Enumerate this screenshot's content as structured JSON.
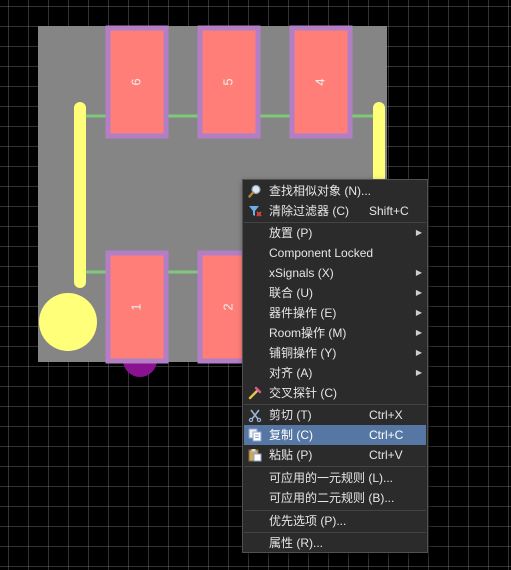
{
  "pcb": {
    "pads": [
      "6",
      "5",
      "4",
      "1",
      "2"
    ]
  },
  "context_menu": {
    "items": [
      {
        "icon": "magnifier-icon",
        "label": "查找相似对象 (N)...",
        "shortcut": "",
        "submenu": false
      },
      {
        "icon": "clear-filter-icon",
        "label": "清除过滤器 (C)",
        "shortcut": "Shift+C",
        "submenu": false
      },
      {
        "icon": "",
        "label": "放置 (P)",
        "shortcut": "",
        "submenu": true
      },
      {
        "icon": "",
        "label": "Component Locked",
        "shortcut": "",
        "submenu": false
      },
      {
        "icon": "",
        "label": "xSignals (X)",
        "shortcut": "",
        "submenu": true
      },
      {
        "icon": "",
        "label": "联合 (U)",
        "shortcut": "",
        "submenu": true
      },
      {
        "icon": "",
        "label": "器件操作 (E)",
        "shortcut": "",
        "submenu": true
      },
      {
        "icon": "",
        "label": "Room操作 (M)",
        "shortcut": "",
        "submenu": true
      },
      {
        "icon": "",
        "label": "铺铜操作 (Y)",
        "shortcut": "",
        "submenu": true
      },
      {
        "icon": "",
        "label": "对齐 (A)",
        "shortcut": "",
        "submenu": true
      },
      {
        "icon": "cross-probe-icon",
        "label": "交叉探针 (C)",
        "shortcut": "",
        "submenu": false
      },
      {
        "icon": "scissors-icon",
        "label": "剪切 (T)",
        "shortcut": "Ctrl+X",
        "submenu": false
      },
      {
        "icon": "copy-icon",
        "label": "复制 (C)",
        "shortcut": "Ctrl+C",
        "submenu": false,
        "highlighted": true
      },
      {
        "icon": "paste-icon",
        "label": "粘贴 (P)",
        "shortcut": "Ctrl+V",
        "submenu": false
      },
      {
        "icon": "",
        "label": "可应用的一元规则 (L)...",
        "shortcut": "",
        "submenu": false
      },
      {
        "icon": "",
        "label": "可应用的二元规则 (B)...",
        "shortcut": "",
        "submenu": false
      },
      {
        "icon": "",
        "label": "优先选项 (P)...",
        "shortcut": "",
        "submenu": false
      },
      {
        "icon": "",
        "label": "属性 (R)...",
        "shortcut": "",
        "submenu": false
      }
    ]
  },
  "colors": {
    "board": "#858585",
    "pad_fill": "#ff7e78",
    "pad_border": "#b27ec6",
    "silkscreen": "#ffff7a",
    "trace": "#7ec97a",
    "via": "#8a1290",
    "menu_bg": "#2b2b2b",
    "menu_highlight": "#5677a3"
  }
}
